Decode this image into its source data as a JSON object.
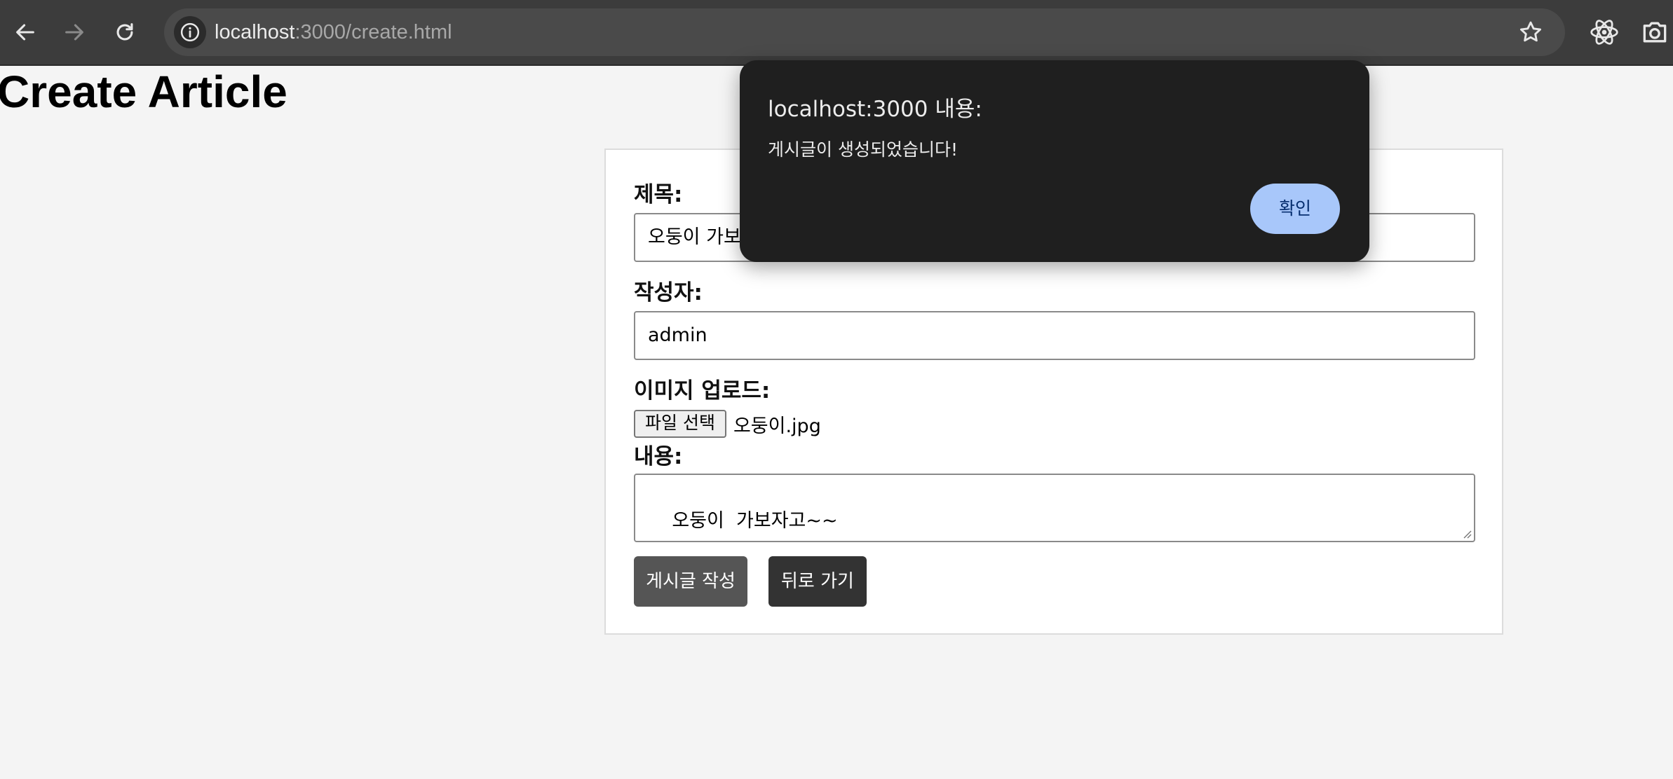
{
  "browser": {
    "url_host": "localhost",
    "url_path": ":3000/create.html",
    "icons": {
      "back": "arrow-left-icon",
      "forward": "arrow-right-icon",
      "reload": "reload-icon",
      "site_info": "info-icon",
      "bookmark": "star-icon",
      "react_devtools": "react-icon",
      "screenshot": "camera-icon"
    }
  },
  "page": {
    "title": "Create Article"
  },
  "form": {
    "title_label": "제목:",
    "title_value": "오둥이 가보",
    "author_label": "작성자:",
    "author_value": "admin",
    "image_label": "이미지 업로드:",
    "file_button": "파일 선택",
    "file_name": "오둥이.jpg",
    "content_label": "내용:",
    "content_value": "오둥이  가보자고~~",
    "submit_button": "게시글 작성",
    "back_button": "뒤로 가기"
  },
  "alert": {
    "title": "localhost:3000 내용:",
    "message": "게시글이 생성되었습니다!",
    "ok_button": "확인"
  },
  "colors": {
    "page_bg": "#f4f4f4",
    "chrome_bg": "#3c3c3c",
    "dialog_bg": "#1f1f1f",
    "dialog_button": "#a8c7fa",
    "submit_button": "#555555",
    "back_button": "#333333"
  }
}
